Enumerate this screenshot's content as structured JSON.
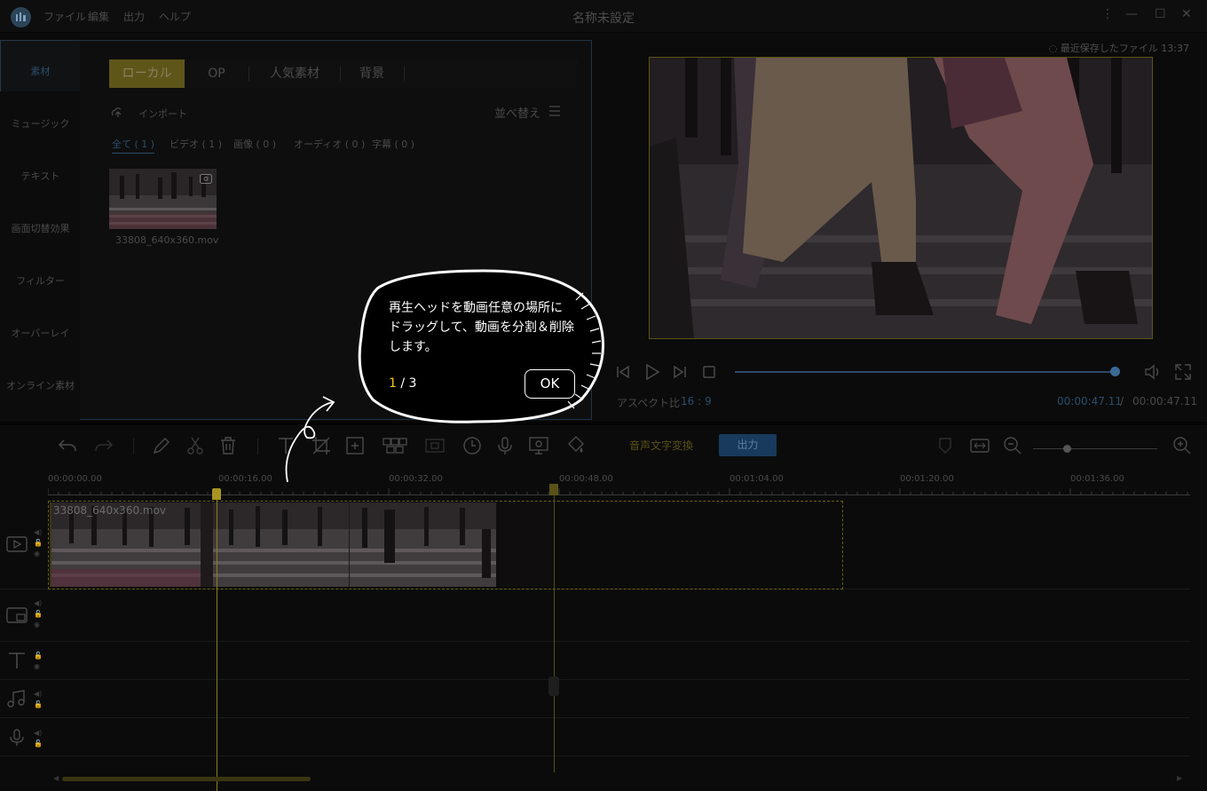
{
  "titlebar": {
    "title": "名称未設定",
    "menus": [
      "ファイル",
      "編集",
      "出力",
      "ヘルプ"
    ]
  },
  "leftnav": {
    "items": [
      "素材",
      "ミュージック",
      "テキスト",
      "画面切替効果",
      "フィルター",
      "オーバーレイ",
      "オンライン素材"
    ]
  },
  "media": {
    "tabs": [
      "ローカル",
      "OP",
      "人気素材",
      "背景"
    ],
    "import_label": "インポート",
    "sort_label": "並べ替え",
    "filters": [
      "全て ( 1 )",
      "ビデオ ( 1 )",
      "画像 ( 0 )",
      "オーディオ ( 0 )",
      "字幕 ( 0 )"
    ],
    "file_name": "33808_640x360.mov"
  },
  "preview": {
    "saved_label": "最近保存したファイル 13:37",
    "aspect_label": "アスペクト比",
    "aspect_value": "16 : 9",
    "time_current": "00:00:47.11",
    "time_sep": "/",
    "time_total": "00:00:47.11",
    "progress": 1.0
  },
  "timeline": {
    "speech_to_text": "音声文字変換",
    "export_label": "出力",
    "ticks": [
      "00:00:00.00",
      "00:00:16.00",
      "00:00:32.00",
      "00:00:48.00",
      "00:01:04.00",
      "00:01:20.00",
      "00:01:36.00"
    ],
    "clip_name": "33808_640x360.mov"
  },
  "tooltip": {
    "text_line1": "再生ヘッドを動画任意の場所に",
    "text_line2": "ドラッグして、動画を分割＆削除",
    "text_line3": "します。",
    "step_current": "1",
    "step_total": " / 3",
    "ok_label": "OK"
  },
  "colors": {
    "accent_yellow": "#f5c518",
    "accent_blue": "#2b4e6b",
    "tab_active": "#5e5519"
  }
}
